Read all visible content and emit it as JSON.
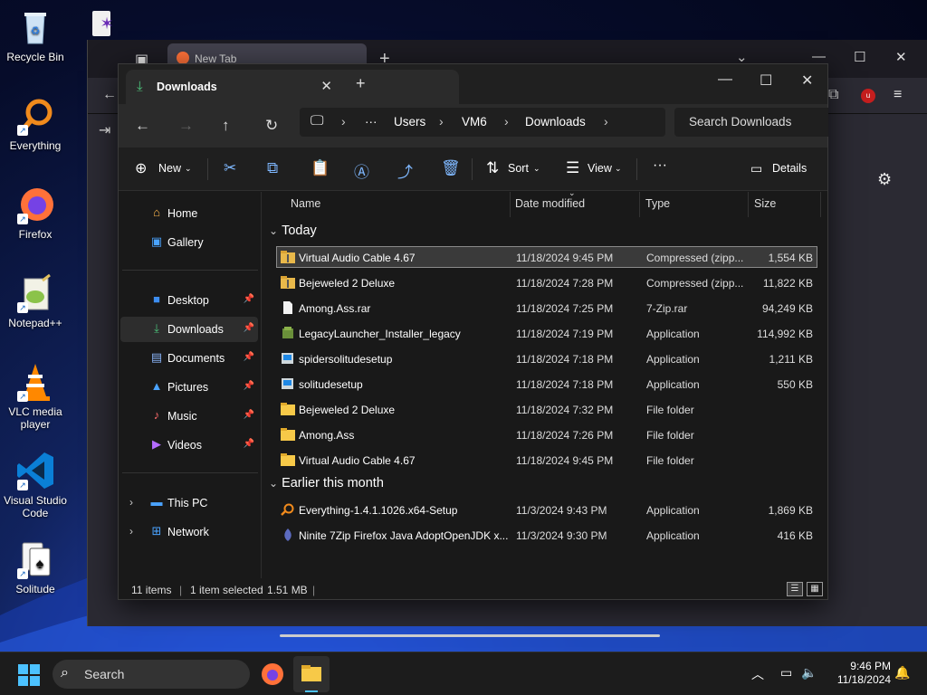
{
  "desktop": {
    "icons": [
      {
        "label": "Recycle Bin"
      },
      {
        "label": "Everything"
      },
      {
        "label": "Firefox"
      },
      {
        "label": "Notepad++"
      },
      {
        "label": "VLC media player"
      },
      {
        "label": "Visual Studio Code"
      },
      {
        "label": "Solitude"
      }
    ]
  },
  "browser": {
    "tab_title": "New Tab"
  },
  "explorer": {
    "tab_title": "Downloads",
    "breadcrumb": [
      "Users",
      "VM6",
      "Downloads"
    ],
    "search_placeholder": "Search Downloads",
    "commands": {
      "new": "New",
      "sort": "Sort",
      "view": "View",
      "details": "Details"
    },
    "nav": {
      "quick": [
        {
          "label": "Home"
        },
        {
          "label": "Gallery"
        }
      ],
      "pinned": [
        {
          "label": "Desktop"
        },
        {
          "label": "Downloads"
        },
        {
          "label": "Documents"
        },
        {
          "label": "Pictures"
        },
        {
          "label": "Music"
        },
        {
          "label": "Videos"
        }
      ],
      "roots": [
        {
          "label": "This PC"
        },
        {
          "label": "Network"
        }
      ]
    },
    "columns": {
      "name": "Name",
      "date": "Date modified",
      "type": "Type",
      "size": "Size"
    },
    "groups": [
      {
        "label": "Today",
        "rows": [
          {
            "name": "Virtual Audio Cable 4.67",
            "date": "11/18/2024 9:45 PM",
            "type": "Compressed (zipp...",
            "size": "1,554 KB",
            "icon": "zip-folder-icon",
            "selected": true
          },
          {
            "name": "Bejeweled 2 Deluxe",
            "date": "11/18/2024 7:28 PM",
            "type": "Compressed (zipp...",
            "size": "11,822 KB",
            "icon": "zip-folder-icon"
          },
          {
            "name": "Among.Ass.rar",
            "date": "11/18/2024 7:25 PM",
            "type": "7-Zip.rar",
            "size": "94,249 KB",
            "icon": "file-icon"
          },
          {
            "name": "LegacyLauncher_Installer_legacy",
            "date": "11/18/2024 7:19 PM",
            "type": "Application",
            "size": "114,992 KB",
            "icon": "installer-icon"
          },
          {
            "name": "spidersolitudesetup",
            "date": "11/18/2024 7:18 PM",
            "type": "Application",
            "size": "1,211 KB",
            "icon": "setup-icon"
          },
          {
            "name": "solitudesetup",
            "date": "11/18/2024 7:18 PM",
            "type": "Application",
            "size": "550 KB",
            "icon": "setup-icon"
          },
          {
            "name": "Bejeweled 2 Deluxe",
            "date": "11/18/2024 7:32 PM",
            "type": "File folder",
            "size": "",
            "icon": "folder-icon"
          },
          {
            "name": "Among.Ass",
            "date": "11/18/2024 7:26 PM",
            "type": "File folder",
            "size": "",
            "icon": "folder-icon"
          },
          {
            "name": "Virtual Audio Cable 4.67",
            "date": "11/18/2024 9:45 PM",
            "type": "File folder",
            "size": "",
            "icon": "folder-icon"
          }
        ]
      },
      {
        "label": "Earlier this month",
        "rows": [
          {
            "name": "Everything-1.4.1.1026.x64-Setup",
            "date": "11/3/2024 9:43 PM",
            "type": "Application",
            "size": "1,869 KB",
            "icon": "everything-icon"
          },
          {
            "name": "Ninite 7Zip Firefox Java AdoptOpenJDK x...",
            "date": "11/3/2024 9:30 PM",
            "type": "Application",
            "size": "416 KB",
            "icon": "ninite-icon"
          }
        ]
      }
    ],
    "status": {
      "items": "11 items",
      "selected": "1 item selected",
      "size": "1.51 MB"
    }
  },
  "taskbar": {
    "search_label": "Search",
    "time": "9:46 PM",
    "date": "11/18/2024"
  }
}
